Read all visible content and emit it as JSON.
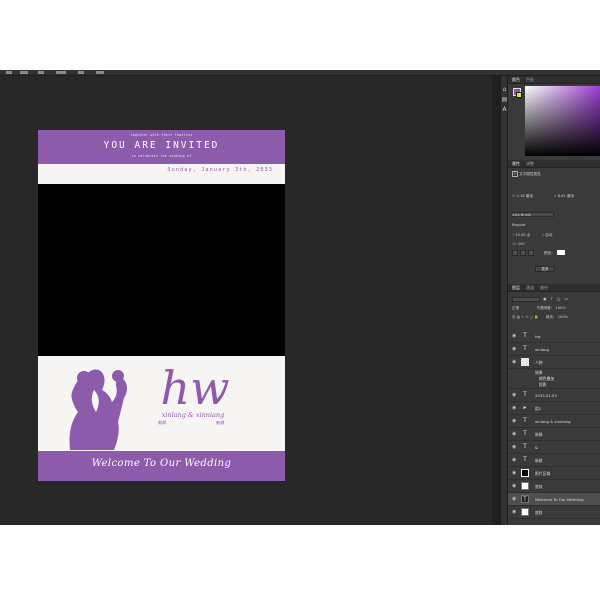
{
  "document": {
    "tagline_top": "together with their families",
    "title": "YOU ARE INVITED",
    "tagline_bottom": "to celebrate the wedding of",
    "date": "Sunday, January 3th, 2033",
    "monogram": "hw",
    "names": "xinlang & xinniang",
    "groom_cn": "新郎",
    "bride_cn": "新娘",
    "footer": "Welcome To Our Wedding",
    "colors": {
      "purple": "#8d5bab",
      "cream": "#f7f5f3",
      "photo": "#000000"
    }
  },
  "panels": {
    "color_tabs": [
      "颜色",
      "色板"
    ],
    "properties_tabs": [
      "属性",
      "调整"
    ],
    "properties": {
      "kind": "文字图层属性",
      "size": "1.18 厘米",
      "position": "8.61 厘米",
      "font": "Alex Brush",
      "style": "Regular",
      "font_size": "10.00 点",
      "leading": "自动",
      "tracking": "100",
      "color_label": "颜色：",
      "button": "更多"
    },
    "layers_tabs": [
      "图层",
      "通道",
      "路径"
    ],
    "layers_header": {
      "kind": "正常",
      "opacity_label": "不透明度：",
      "opacity": "100%",
      "fill_label": "填充：",
      "fill": "100%"
    },
    "layers": [
      {
        "name": "hw",
        "thumb": "T",
        "kind": "text"
      },
      {
        "name": "xinlang",
        "thumb": "T",
        "kind": "text"
      },
      {
        "name": "人物",
        "thumb": "",
        "kind": "pixel"
      },
      {
        "name": "效果",
        "thumb": "",
        "kind": "effect"
      },
      {
        "name": "2033.01.03",
        "thumb": "T",
        "kind": "text"
      },
      {
        "name": "组1",
        "thumb": "▸",
        "kind": "group"
      },
      {
        "name": "xinlang & xinniang",
        "thumb": "T",
        "kind": "text"
      },
      {
        "name": "新郎",
        "thumb": "T",
        "kind": "text"
      },
      {
        "name": "&",
        "thumb": "T",
        "kind": "text"
      },
      {
        "name": "新娘",
        "thumb": "T",
        "kind": "text"
      },
      {
        "name": "照片区域",
        "thumb": "",
        "kind": "photo"
      },
      {
        "name": "底纹",
        "thumb": "",
        "kind": "pixel"
      },
      {
        "name": "Welcome To Our Wedding",
        "thumb": "T",
        "kind": "text",
        "selected": true
      },
      {
        "name": "底纹",
        "thumb": "",
        "kind": "pixel"
      }
    ],
    "effect_items": [
      "颜色叠加",
      "投影"
    ]
  }
}
